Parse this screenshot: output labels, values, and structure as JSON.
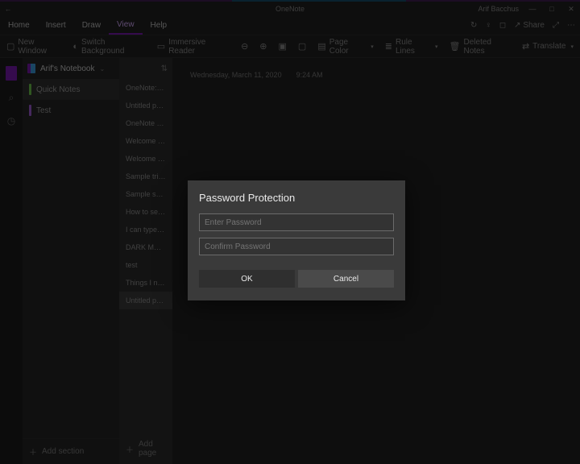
{
  "titlebar": {
    "app_name": "OneNote",
    "user_name": "Arif Bacchus"
  },
  "menu": {
    "items": [
      "Home",
      "Insert",
      "Draw",
      "View",
      "Help"
    ],
    "active_index": 3,
    "share_label": "Share"
  },
  "ribbon": {
    "new_window": "New Window",
    "switch_background": "Switch Background",
    "immersive_reader": "Immersive Reader",
    "page_color": "Page Color",
    "rule_lines": "Rule Lines",
    "deleted_notes": "Deleted Notes",
    "translate": "Translate"
  },
  "notebook": {
    "name": "Arif's Notebook"
  },
  "sections": {
    "items": [
      {
        "label": "Quick Notes",
        "color": "green",
        "active": true
      },
      {
        "label": "Test",
        "color": "purple",
        "active": false
      }
    ],
    "add_label": "Add section"
  },
  "pages": {
    "items": [
      "OneNote: on…",
      "Untitled page",
      "OneNote Bas…",
      "Welcome to…",
      "Welcome to …",
      "Sample trip p…",
      "Sample shop…",
      "How to set u…",
      "I can type on…",
      "DARK MODE…",
      "test",
      "Things I need…",
      "Untitled page"
    ],
    "active_index": 12,
    "add_label": "Add page"
  },
  "canvas": {
    "date": "Wednesday, March 11, 2020",
    "time": "9:24 AM"
  },
  "dialog": {
    "title": "Password Protection",
    "enter_placeholder": "Enter Password",
    "confirm_placeholder": "Confirm Password",
    "ok": "OK",
    "cancel": "Cancel"
  }
}
